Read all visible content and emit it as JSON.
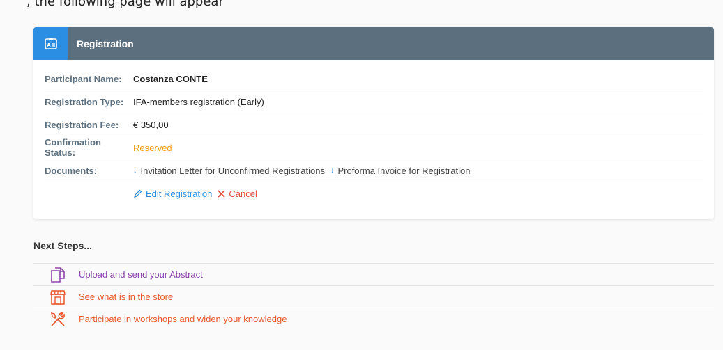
{
  "top_cut_text": ", the following page will appear",
  "colors": {
    "header_bg": "#5b6f7e",
    "accent": "#2b8ee3",
    "status_reserved": "#f39c12",
    "cancel": "#e74c3c",
    "step_purple": "#8e44ad",
    "step_orange": "#e8582b"
  },
  "card": {
    "title": "Registration",
    "icon": "id-card-icon"
  },
  "fields": {
    "participant_label": "Participant Name:",
    "participant_value": "Costanza CONTE",
    "type_label": "Registration Type:",
    "type_value": "IFA-members registration (Early)",
    "fee_label": "Registration Fee:",
    "fee_value": "€ 350,00",
    "status_label": "Confirmation Status:",
    "status_value": "Reserved",
    "documents_label": "Documents:"
  },
  "documents": [
    {
      "label": "Invitation Letter for Unconfirmed Registrations",
      "icon": "download-arrow-icon"
    },
    {
      "label": "Proforma Invoice for Registration",
      "icon": "download-arrow-icon"
    }
  ],
  "actions": {
    "edit_label": "Edit Registration",
    "cancel_label": "Cancel"
  },
  "next_steps": {
    "title": "Next Steps...",
    "items": [
      {
        "label": "Upload and send your Abstract",
        "icon": "documents-icon"
      },
      {
        "label": "See what is in the store",
        "icon": "store-icon"
      },
      {
        "label": "Participate in workshops and widen your knowledge",
        "icon": "tools-icon"
      }
    ]
  }
}
